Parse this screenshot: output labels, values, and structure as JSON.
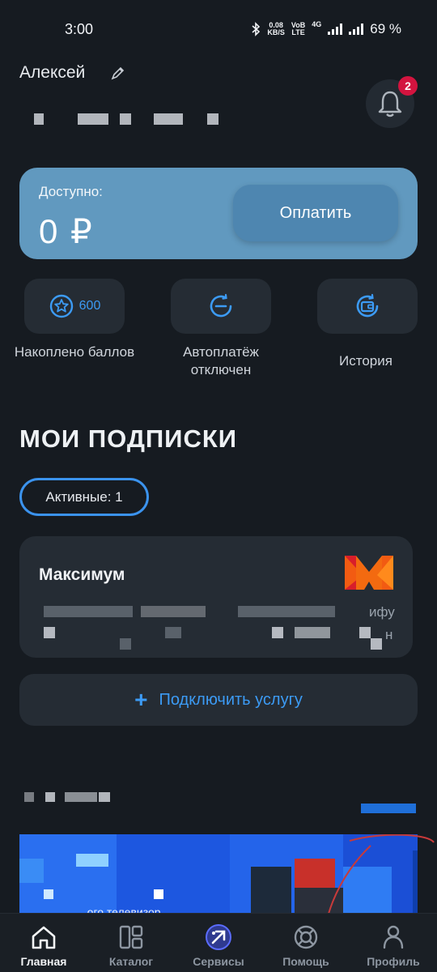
{
  "status_bar": {
    "time": "3:00",
    "net_speed_value": "0.08",
    "net_speed_unit": "KB/S",
    "volte_top": "VoB",
    "volte_bottom": "LTE",
    "network": "4G",
    "battery": "69 %"
  },
  "profile": {
    "name": "Алексей",
    "notifications_count": "2"
  },
  "balance": {
    "label": "Доступно:",
    "value": "0 ₽",
    "pay_button": "Оплатить"
  },
  "quick_actions": [
    {
      "label": "Накоплено баллов",
      "value": "600",
      "icon": "star-circle-icon"
    },
    {
      "label": "Автоплатёж отключен",
      "icon": "minus-circle-icon"
    },
    {
      "label": "История",
      "icon": "wallet-history-icon"
    }
  ],
  "subscriptions": {
    "title": "МОИ ПОДПИСКИ",
    "active_chip": "Активные: 1",
    "card": {
      "title": "Максимум",
      "tail_1": "ифу",
      "tail_2": "н"
    },
    "connect_button": "Подключить услугу"
  },
  "banner": {
    "text": "...ого телевизор"
  },
  "bottom_nav": [
    {
      "label": "Главная",
      "icon": "home-icon",
      "active": true
    },
    {
      "label": "Каталог",
      "icon": "catalog-icon",
      "active": false
    },
    {
      "label": "Сервисы",
      "icon": "services-icon",
      "active": false
    },
    {
      "label": "Помощь",
      "icon": "lifebuoy-icon",
      "active": false
    },
    {
      "label": "Профиль",
      "icon": "profile-icon",
      "active": false
    }
  ],
  "colors": {
    "background": "#161b21",
    "card": "#252c34",
    "accent_blue": "#3c9bf5",
    "balance_card": "#6199bf",
    "badge_red": "#d3143f",
    "annotation_red": "#c83a3a"
  }
}
